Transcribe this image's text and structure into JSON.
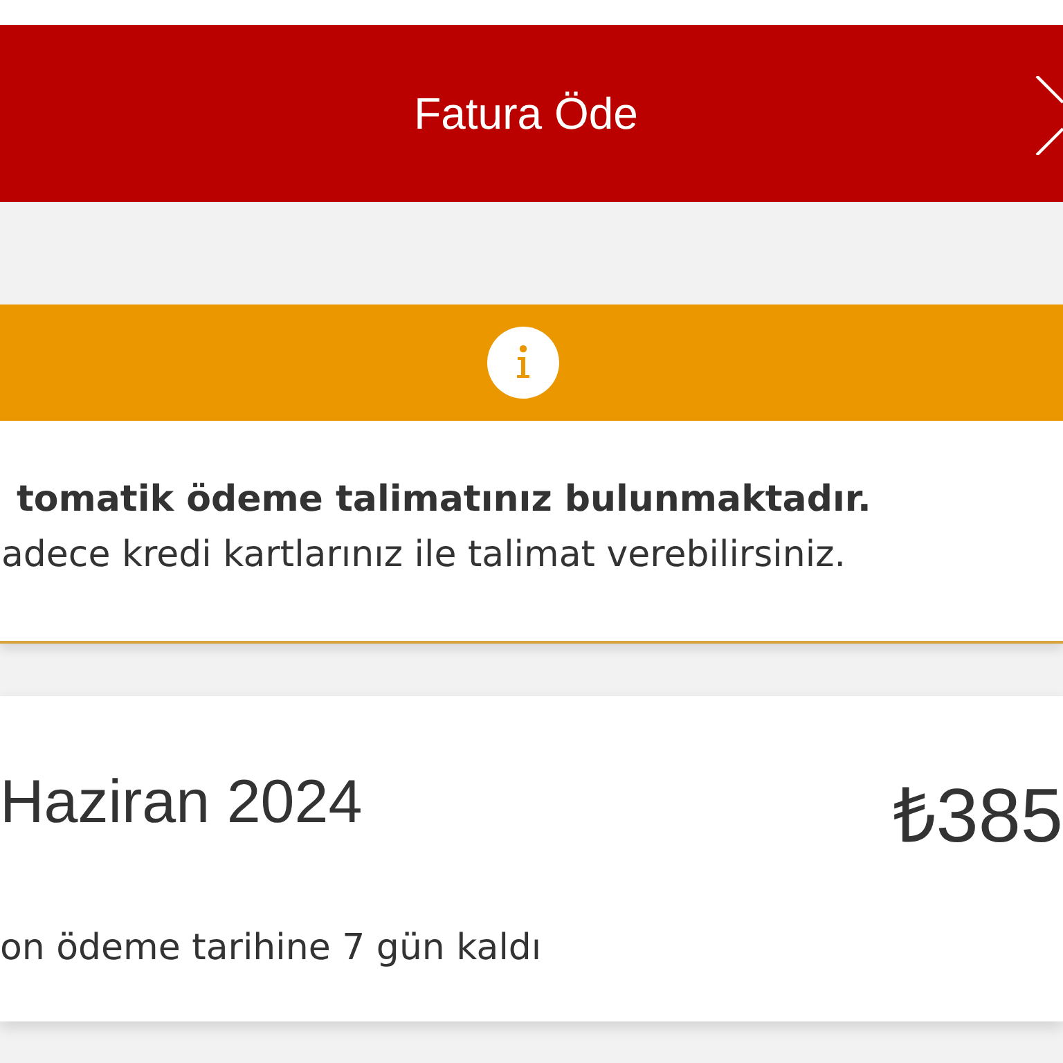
{
  "header": {
    "title": "Fatura Öde"
  },
  "notice": {
    "kind": "info",
    "title": "tomatik ödeme talimatınız bulunmaktadır.",
    "message": "adece kredi kartlarınız ile talimat verebilirsiniz."
  },
  "bill": {
    "period": "Haziran 2024",
    "amount": "₺385",
    "due_note": "on ödeme tarihine 7 gün kaldı"
  }
}
